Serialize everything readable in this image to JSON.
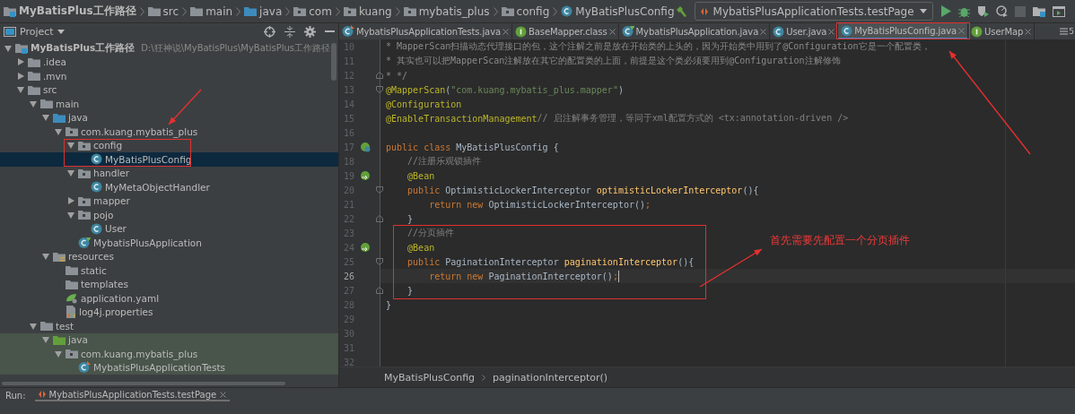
{
  "breadcrumb": [
    {
      "label": "MyBatisPlus工作路径",
      "kind": "module"
    },
    {
      "label": "src",
      "kind": "folder"
    },
    {
      "label": "main",
      "kind": "folder"
    },
    {
      "label": "java",
      "kind": "src-folder"
    },
    {
      "label": "com",
      "kind": "package"
    },
    {
      "label": "kuang",
      "kind": "package"
    },
    {
      "label": "mybatis_plus",
      "kind": "package"
    },
    {
      "label": "config",
      "kind": "package"
    },
    {
      "label": "MyBatisPlusConfig",
      "kind": "class"
    }
  ],
  "run_config": "MybatisPlusApplicationTests.testPage",
  "project_panel": {
    "title": "Project",
    "tree": [
      {
        "label": "MyBatisPlus工作路径",
        "hint": "D:\\狂神说\\MyBatisPlus\\MyBatisPlus工作路径",
        "kind": "module",
        "expanded": true,
        "selected": false,
        "test_scope": false,
        "children": [
          {
            "label": ".idea",
            "kind": "folder",
            "expanded": false,
            "selected": false,
            "test_scope": false
          },
          {
            "label": ".mvn",
            "kind": "folder",
            "expanded": false,
            "selected": false,
            "test_scope": false
          },
          {
            "label": "src",
            "kind": "folder",
            "expanded": true,
            "selected": false,
            "test_scope": false,
            "children": [
              {
                "label": "main",
                "kind": "folder",
                "expanded": true,
                "selected": false,
                "test_scope": false,
                "children": [
                  {
                    "label": "java",
                    "kind": "src-folder",
                    "expanded": true,
                    "selected": false,
                    "test_scope": false,
                    "children": [
                      {
                        "label": "com.kuang.mybatis_plus",
                        "kind": "package",
                        "expanded": true,
                        "selected": false,
                        "test_scope": false,
                        "children": [
                          {
                            "label": "config",
                            "kind": "package",
                            "expanded": true,
                            "selected": false,
                            "test_scope": false,
                            "children": [
                              {
                                "label": "MyBatisPlusConfig",
                                "kind": "class",
                                "selected": true,
                                "test_scope": false
                              }
                            ]
                          },
                          {
                            "label": "handler",
                            "kind": "package",
                            "expanded": true,
                            "selected": false,
                            "test_scope": false,
                            "children": [
                              {
                                "label": "MyMetaObjectHandler",
                                "kind": "class",
                                "selected": false,
                                "test_scope": false
                              }
                            ]
                          },
                          {
                            "label": "mapper",
                            "kind": "package",
                            "expanded": false,
                            "selected": false,
                            "test_scope": false
                          },
                          {
                            "label": "pojo",
                            "kind": "package",
                            "expanded": true,
                            "selected": false,
                            "test_scope": false,
                            "children": [
                              {
                                "label": "User",
                                "kind": "class",
                                "selected": false,
                                "test_scope": false
                              }
                            ]
                          },
                          {
                            "label": "MybatisPlusApplication",
                            "kind": "spring-class",
                            "selected": false,
                            "test_scope": false
                          }
                        ]
                      }
                    ]
                  },
                  {
                    "label": "resources",
                    "kind": "resources",
                    "expanded": true,
                    "selected": false,
                    "test_scope": false,
                    "children": [
                      {
                        "label": "static",
                        "kind": "folder",
                        "selected": false,
                        "test_scope": false
                      },
                      {
                        "label": "templates",
                        "kind": "folder",
                        "selected": false,
                        "test_scope": false
                      },
                      {
                        "label": "application.yaml",
                        "kind": "yaml",
                        "selected": false,
                        "test_scope": false
                      },
                      {
                        "label": "log4j.properties",
                        "kind": "properties",
                        "selected": false,
                        "test_scope": false
                      }
                    ]
                  }
                ]
              },
              {
                "label": "test",
                "kind": "folder",
                "expanded": true,
                "selected": false,
                "test_scope": false,
                "children": [
                  {
                    "label": "java",
                    "kind": "test-folder",
                    "expanded": true,
                    "selected": false,
                    "test_scope": true,
                    "children": [
                      {
                        "label": "com.kuang.mybatis_plus",
                        "kind": "package",
                        "expanded": true,
                        "selected": false,
                        "test_scope": true,
                        "children": [
                          {
                            "label": "MybatisPlusApplicationTests",
                            "kind": "test-class",
                            "selected": false,
                            "test_scope": true
                          }
                        ]
                      }
                    ]
                  }
                ]
              }
            ]
          }
        ]
      }
    ]
  },
  "tabs": [
    {
      "label": "MybatisPlusApplicationTests.java",
      "kind": "test-class",
      "selected": false
    },
    {
      "label": "BaseMapper.class",
      "kind": "interface",
      "selected": false
    },
    {
      "label": "MybatisPlusApplication.java",
      "kind": "spring-class",
      "selected": false
    },
    {
      "label": "User.java",
      "kind": "class",
      "selected": false
    },
    {
      "label": "MyBatisPlusConfig.java",
      "kind": "class",
      "selected": true
    },
    {
      "label": "UserMap",
      "kind": "interface",
      "selected": false
    }
  ],
  "tabs_overflow": "5",
  "editor": {
    "lines": [
      {
        "number": "10",
        "current": false,
        "kind": "plain",
        "tokens": [
          {
            "kind": "doc",
            "text": "* MapperScan扫描动态代理接口的包，这个注解之前是放在开始类的上头的，因为开始类中用到了@Configuration它是一个配置类，"
          }
        ]
      },
      {
        "number": "11",
        "current": false,
        "kind": "plain",
        "tokens": [
          {
            "kind": "doc",
            "text": "* 其实也可以把MapperScan注解放在其它的配置类的上面，前提是这个类必须要用到@Configuration注解修饰"
          }
        ]
      },
      {
        "number": "12",
        "current": false,
        "kind": "fold-end",
        "tokens": [
          {
            "kind": "doc",
            "text": "* */"
          }
        ]
      },
      {
        "number": "13",
        "current": false,
        "kind": "fold-start",
        "tokens": [
          {
            "kind": "annotation",
            "text": "@MapperScan"
          },
          {
            "kind": "plain",
            "text": "("
          },
          {
            "kind": "string",
            "text": "\"com.kuang.mybatis_plus.mapper\""
          },
          {
            "kind": "plain",
            "text": ")"
          }
        ]
      },
      {
        "number": "14",
        "current": false,
        "kind": "plain",
        "tokens": [
          {
            "kind": "annotation",
            "text": "@Configuration"
          }
        ]
      },
      {
        "number": "15",
        "current": false,
        "kind": "plain",
        "tokens": [
          {
            "kind": "annotation",
            "text": "@EnableTransactionManagement"
          },
          {
            "kind": "comment",
            "text": "// 启注解事务管理，等同于xml配置方式的 <tx:annotation-driven />"
          }
        ]
      },
      {
        "number": "16",
        "current": false,
        "kind": "plain"
      },
      {
        "number": "17",
        "current": false,
        "kind": "bean-class",
        "tokens": [
          {
            "kind": "keyword",
            "text": "public class "
          },
          {
            "kind": "plain",
            "text": "MyBatisPlusConfig {"
          }
        ]
      },
      {
        "number": "18",
        "current": false,
        "kind": "plain",
        "tokens": [
          {
            "kind": "comment",
            "text": "    //注册乐观锁插件"
          }
        ]
      },
      {
        "number": "19",
        "current": false,
        "kind": "bean",
        "tokens": [
          {
            "kind": "annotation",
            "text": "    @Bean"
          }
        ]
      },
      {
        "number": "20",
        "current": false,
        "kind": "fold-start",
        "tokens": [
          {
            "kind": "keyword",
            "text": "    public "
          },
          {
            "kind": "plain",
            "text": "OptimisticLockerInterceptor "
          },
          {
            "kind": "method",
            "text": "optimisticLockerInterceptor"
          },
          {
            "kind": "plain",
            "text": "(){"
          }
        ]
      },
      {
        "number": "21",
        "current": false,
        "kind": "plain",
        "tokens": [
          {
            "kind": "keyword",
            "text": "        return new "
          },
          {
            "kind": "plain",
            "text": "OptimisticLockerInterceptor()"
          },
          {
            "kind": "keyword",
            "text": ";"
          }
        ]
      },
      {
        "number": "22",
        "current": false,
        "kind": "fold-end",
        "tokens": [
          {
            "kind": "plain",
            "text": "    }"
          }
        ]
      },
      {
        "number": "23",
        "current": false,
        "kind": "plain",
        "tokens": [
          {
            "kind": "comment",
            "text": "    //分页插件"
          }
        ]
      },
      {
        "number": "24",
        "current": false,
        "kind": "bean",
        "tokens": [
          {
            "kind": "annotation",
            "text": "    @Bean"
          }
        ]
      },
      {
        "number": "25",
        "current": false,
        "kind": "fold-start",
        "tokens": [
          {
            "kind": "keyword",
            "text": "    public "
          },
          {
            "kind": "plain",
            "text": "PaginationInterceptor "
          },
          {
            "kind": "method",
            "text": "paginationInterceptor"
          },
          {
            "kind": "plain",
            "text": "(){"
          }
        ]
      },
      {
        "number": "26",
        "current": true,
        "kind": "plain",
        "tokens": [
          {
            "kind": "keyword",
            "text": "        return new "
          },
          {
            "kind": "plain",
            "text": "PaginationInterceptor()"
          },
          {
            "kind": "keyword",
            "text": ";"
          }
        ]
      },
      {
        "number": "27",
        "current": false,
        "kind": "fold-end",
        "tokens": [
          {
            "kind": "plain",
            "text": "    }"
          }
        ]
      },
      {
        "number": "28",
        "current": false,
        "kind": "plain",
        "tokens": [
          {
            "kind": "plain",
            "text": "}"
          }
        ]
      },
      {
        "number": "29",
        "current": false,
        "kind": "plain"
      },
      {
        "number": "30",
        "current": false,
        "kind": "plain"
      },
      {
        "number": "31",
        "current": false,
        "kind": "plain"
      },
      {
        "number": "32",
        "current": false,
        "kind": "plain"
      }
    ],
    "breadcrumb": [
      "MyBatisPlusConfig",
      "paginationInterceptor()"
    ]
  },
  "run_bar": {
    "label": "Run:",
    "tab": "MybatisPlusApplicationTests.testPage"
  },
  "annotation_note": "首先需要先配置一个分页插件"
}
